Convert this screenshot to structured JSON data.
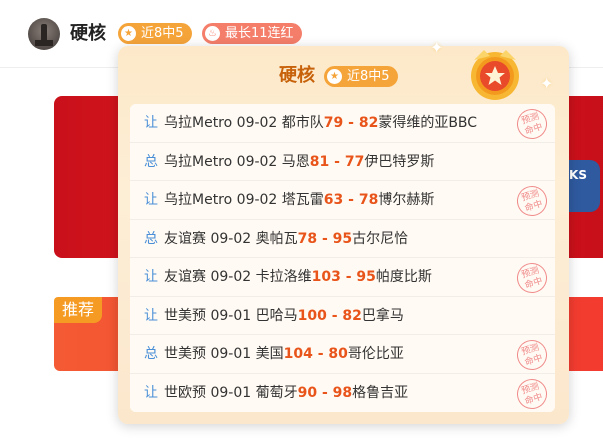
{
  "header": {
    "username": "硬核",
    "tags": [
      {
        "label": "近8中5",
        "icon": "star-icon"
      },
      {
        "label": "最长11连红",
        "icon": "flame-icon"
      }
    ]
  },
  "banner": {
    "badge_text": "KS"
  },
  "recommend": {
    "label": "推荐"
  },
  "popover": {
    "title": "硬核",
    "tag": "近8中5",
    "stamp_text": [
      "预测",
      "命中"
    ],
    "rows": [
      {
        "kind": "让",
        "league": "乌拉Metro",
        "date": "09-02",
        "home": "都市队",
        "home_score": "79",
        "sep": " - ",
        "away_score": "82",
        "away": "蒙得维的亚BBC",
        "hit": true
      },
      {
        "kind": "总",
        "league": "乌拉Metro",
        "date": "09-02",
        "home": "马恩",
        "home_score": "81",
        "sep": " - ",
        "away_score": "77",
        "away": "伊巴特罗斯",
        "hit": false
      },
      {
        "kind": "让",
        "league": "乌拉Metro",
        "date": "09-02",
        "home": "塔瓦雷",
        "home_score": "63",
        "sep": " - ",
        "away_score": "78",
        "away": "博尔赫斯",
        "hit": true
      },
      {
        "kind": "总",
        "league": "友谊赛",
        "date": "09-02",
        "home": "奥帕瓦",
        "home_score": "78",
        "sep": " - ",
        "away_score": "95",
        "away": "古尔尼恰",
        "hit": false
      },
      {
        "kind": "让",
        "league": "友谊赛",
        "date": "09-02",
        "home": "卡拉洛维",
        "home_score": "103",
        "sep": " - ",
        "away_score": "95",
        "away": "帕度比斯",
        "hit": true
      },
      {
        "kind": "让",
        "league": "世美预",
        "date": "09-01",
        "home": "巴哈马",
        "home_score": "100",
        "sep": " - ",
        "away_score": "82",
        "away": "巴拿马",
        "hit": false
      },
      {
        "kind": "总",
        "league": "世美预",
        "date": "09-01",
        "home": "美国",
        "home_score": "104",
        "sep": " - ",
        "away_score": "80",
        "away": "哥伦比亚",
        "hit": true
      },
      {
        "kind": "让",
        "league": "世欧预",
        "date": "09-01",
        "home": "葡萄牙",
        "home_score": "90",
        "sep": " - ",
        "away_score": "98",
        "away": "格鲁吉亚",
        "hit": true
      }
    ]
  },
  "colors": {
    "accent_orange": "#f5a43a",
    "streak_red": "#f47e6a",
    "score": "#e8541a",
    "kind_blue": "#4a8fd8"
  }
}
